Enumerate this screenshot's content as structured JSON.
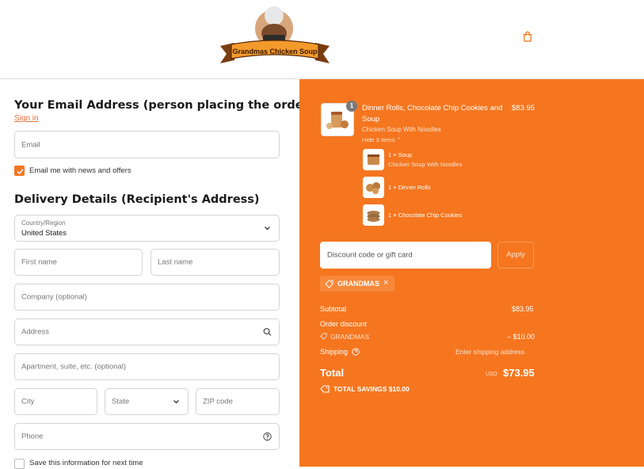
{
  "header": {
    "brand": "Grandmas Chicken Soup"
  },
  "left": {
    "email_heading": "Your Email Address (person placing the order)",
    "sign_in": "Sign in",
    "email_placeholder": "Email",
    "newsletter_label": "Email me with news and offers",
    "delivery_heading": "Delivery Details (Recipient's Address)",
    "country_label": "Country/Region",
    "country_value": "United States",
    "first_name": "First name",
    "last_name": "Last name",
    "company": "Company (optional)",
    "address": "Address",
    "apartment": "Apartment, suite, etc. (optional)",
    "city": "City",
    "state": "State",
    "zip": "ZIP code",
    "phone": "Phone",
    "save_info": "Save this information for next time"
  },
  "summary": {
    "product_qty": "1",
    "product_title_line1": "Dinner Rolls, Chocolate Chip Cookies and",
    "product_title_line2": "Soup",
    "product_price": "$83.95",
    "product_variant": "Chicken Soup With Noodles",
    "hide_items": "Hide 3 items",
    "items": [
      {
        "label": "1 × Soup",
        "sub": "Chicken Soup With Noodles"
      },
      {
        "label": "1 × Dinner Rolls",
        "sub": ""
      },
      {
        "label": "1 × Chocolate Chip Cookies",
        "sub": ""
      }
    ],
    "discount_placeholder": "Discount code or gift card",
    "apply": "Apply",
    "applied_code": "GRANDMAS",
    "subtotal_label": "Subtotal",
    "subtotal_value": "$83.95",
    "order_discount_label": "Order discount",
    "discount_code": "GRANDMAS",
    "discount_value": "– $10.00",
    "shipping_label": "Shipping",
    "shipping_value": "Enter shipping address",
    "total_label": "Total",
    "total_currency": "USD",
    "total_value": "$73.95",
    "savings": "TOTAL SAVINGS  $10.00"
  },
  "colors": {
    "accent": "#f5761f",
    "link": "#e4703a",
    "checkbox": "#f5761f"
  }
}
